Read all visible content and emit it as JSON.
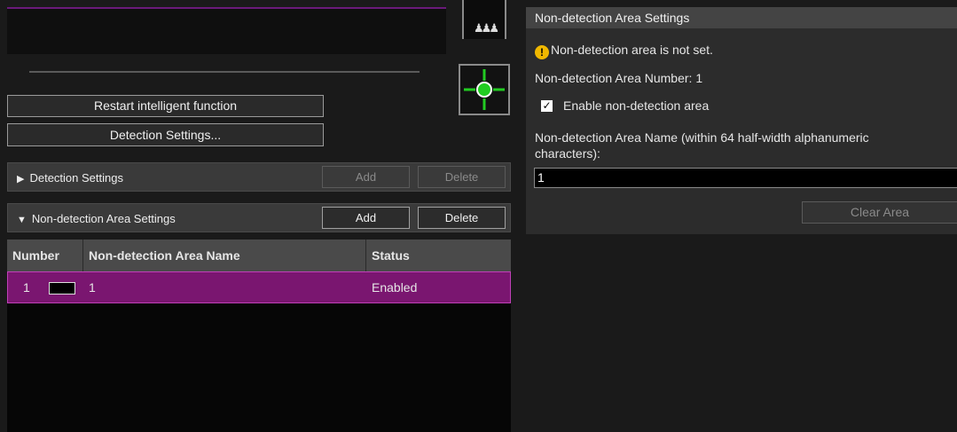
{
  "left": {
    "people_icon": "people-icon",
    "target_icon": "crosshair-target-icon",
    "restart_button": "Restart intelligent function",
    "detection_settings_button": "Detection Settings...",
    "detection_section": {
      "label": "Detection Settings",
      "add": "Add",
      "delete": "Delete"
    },
    "nda_section": {
      "label": "Non-detection Area Settings",
      "add": "Add",
      "delete": "Delete"
    },
    "table": {
      "headers": [
        "Number",
        "Non-detection Area Name",
        "Status"
      ],
      "rows": [
        {
          "number": "1",
          "name": "1",
          "status": "Enabled",
          "color": "#000000"
        }
      ]
    }
  },
  "right": {
    "title": "Non-detection Area Settings",
    "warning": "Non-detection area is not set.",
    "area_number": "Non-detection Area Number: 1",
    "enable_label": "Enable non-detection area",
    "enable_checked": true,
    "name_label_line1": "Non-detection Area Name (within 64 half-width alphanumeric",
    "name_label_line2": "characters):",
    "name_value": "1",
    "clear_button": "Clear Area"
  },
  "colors": {
    "selected_row": "#7a1670",
    "warning": "#f0b800",
    "target_green": "#22cc22"
  }
}
